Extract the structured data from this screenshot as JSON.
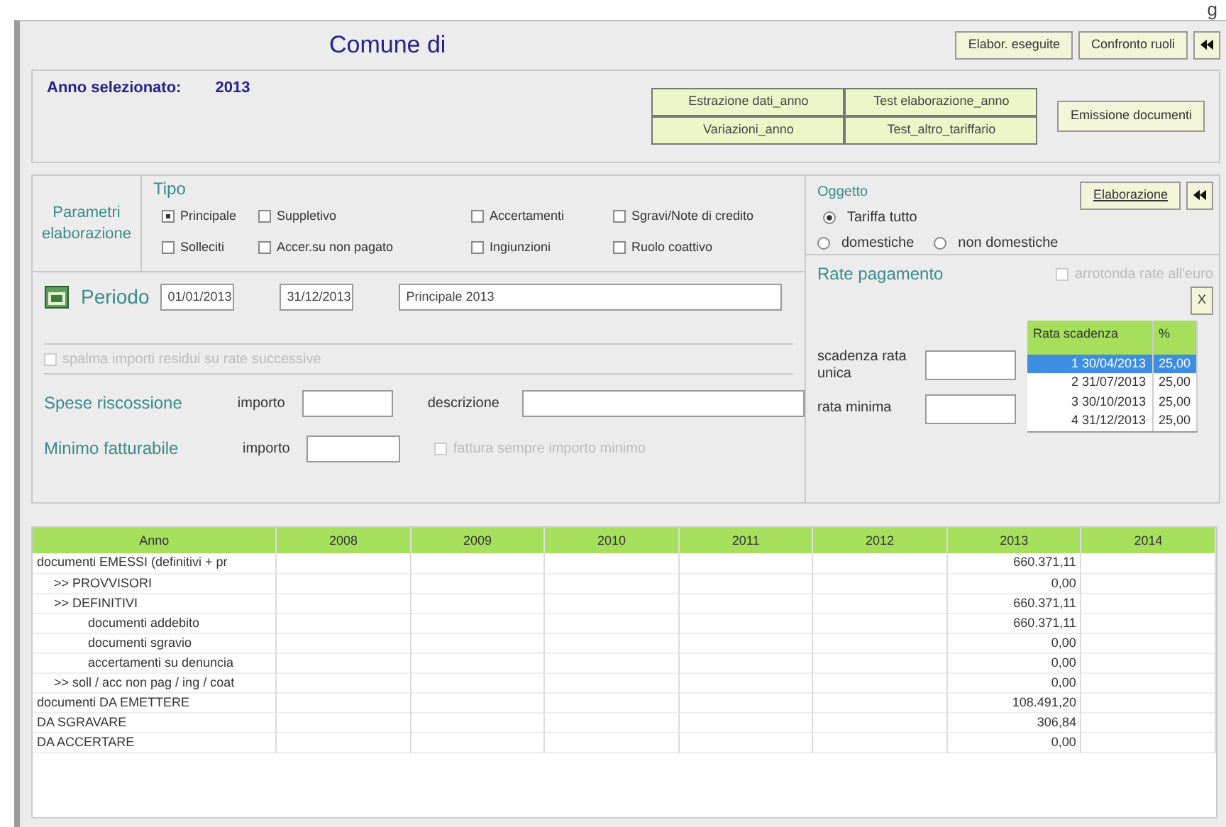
{
  "corner_text": "g",
  "header": {
    "title": "Comune di",
    "buttons": [
      {
        "kind": "text",
        "label": "Elabor. eseguite"
      },
      {
        "kind": "text",
        "label": "Confronto ruoli"
      },
      {
        "kind": "arrow"
      }
    ]
  },
  "year": {
    "label": "Anno selezionato:",
    "value": "2013"
  },
  "actions": [
    "Estrazione dati_anno",
    "Test elaborazione_anno",
    "Variazioni_anno",
    "Test_altro_tariffario"
  ],
  "emission_button": "Emissione documenti",
  "params": {
    "title": "Parametri elaborazione",
    "tipo_label": "Tipo",
    "options": [
      {
        "label": "Principale",
        "checked": true
      },
      {
        "label": "Suppletivo",
        "checked": false
      },
      {
        "label": "Accertamenti",
        "checked": false
      },
      {
        "label": "Sgravi/Note di credito",
        "checked": false
      },
      {
        "label": "Solleciti",
        "checked": false
      },
      {
        "label": "Accer.su non pagato",
        "checked": false
      },
      {
        "label": "Ingiunzioni",
        "checked": false
      },
      {
        "label": "Ruolo coattivo",
        "checked": false
      }
    ]
  },
  "oggetto": {
    "label": "Oggetto",
    "button": "Elaborazione",
    "options": [
      {
        "label": "Tariffa tutto",
        "selected": true
      },
      {
        "label": "domestiche",
        "selected": false
      },
      {
        "label": "non domestiche",
        "selected": false
      }
    ]
  },
  "periodo": {
    "label": "Periodo",
    "from": "01/01/2013",
    "to": "31/12/2013",
    "description": "Principale 2013"
  },
  "spread_option": {
    "label": "spalma importi residui su rate successive",
    "checked": false,
    "disabled": true
  },
  "spese": {
    "label": "Spese riscossione",
    "amount_label": "importo",
    "description_label": "descrizione"
  },
  "minimo": {
    "label": "Minimo fatturabile",
    "amount_label": "importo",
    "option": {
      "label": "fattura sempre importo minimo",
      "checked": false,
      "disabled": true
    }
  },
  "rate": {
    "title": "Rate pagamento",
    "round_option": {
      "label": "arrotonda rate all'euro",
      "checked": false,
      "disabled": true
    },
    "close": "X",
    "single_due_label": "scadenza rata unica",
    "min_label": "rata minima",
    "table": {
      "columns": [
        "Rata scadenza",
        "%"
      ],
      "rows": [
        {
          "cells": [
            "1  30/04/2013",
            "25,00"
          ],
          "selected": true
        },
        {
          "cells": [
            "2  31/07/2013",
            "25,00"
          ],
          "selected": false
        },
        {
          "cells": [
            "3  30/10/2013",
            "25,00"
          ],
          "selected": false
        },
        {
          "cells": [
            "4  31/12/2013",
            "25,00"
          ],
          "selected": false
        }
      ]
    }
  },
  "summary": {
    "columns": [
      "Anno",
      "2008",
      "2009",
      "2010",
      "2011",
      "2012",
      "2013",
      "2014"
    ],
    "rows": [
      {
        "label": "documenti EMESSI (definitivi + pr",
        "cells": [
          null,
          null,
          null,
          null,
          null,
          "660.371,11",
          null
        ],
        "children": [
          {
            "label": ">> PROVVISORI",
            "cells": [
              null,
              null,
              null,
              null,
              null,
              "0,00",
              null
            ]
          },
          {
            "label": ">> DEFINITIVI",
            "cells": [
              null,
              null,
              null,
              null,
              null,
              "660.371,11",
              null
            ],
            "children": [
              {
                "label": "documenti addebito",
                "cells": [
                  null,
                  null,
                  null,
                  null,
                  null,
                  "660.371,11",
                  null
                ]
              },
              {
                "label": "documenti sgravio",
                "cells": [
                  null,
                  null,
                  null,
                  null,
                  null,
                  "0,00",
                  null
                ]
              },
              {
                "label": "accertamenti su denuncia",
                "cells": [
                  null,
                  null,
                  null,
                  null,
                  null,
                  "0,00",
                  null
                ]
              }
            ]
          },
          {
            "label": ">> soll / acc non pag / ing / coat",
            "cells": [
              null,
              null,
              null,
              null,
              null,
              "0,00",
              null
            ]
          }
        ]
      },
      {
        "label": "documenti DA EMETTERE",
        "cells": [
          null,
          null,
          null,
          null,
          null,
          "108.491,20",
          null
        ]
      },
      {
        "label": "DA SGRAVARE",
        "cells": [
          null,
          null,
          null,
          null,
          null,
          "306,84",
          null
        ]
      },
      {
        "label": "DA ACCERTARE",
        "cells": [
          null,
          null,
          null,
          null,
          null,
          "0,00",
          null
        ]
      }
    ]
  }
}
